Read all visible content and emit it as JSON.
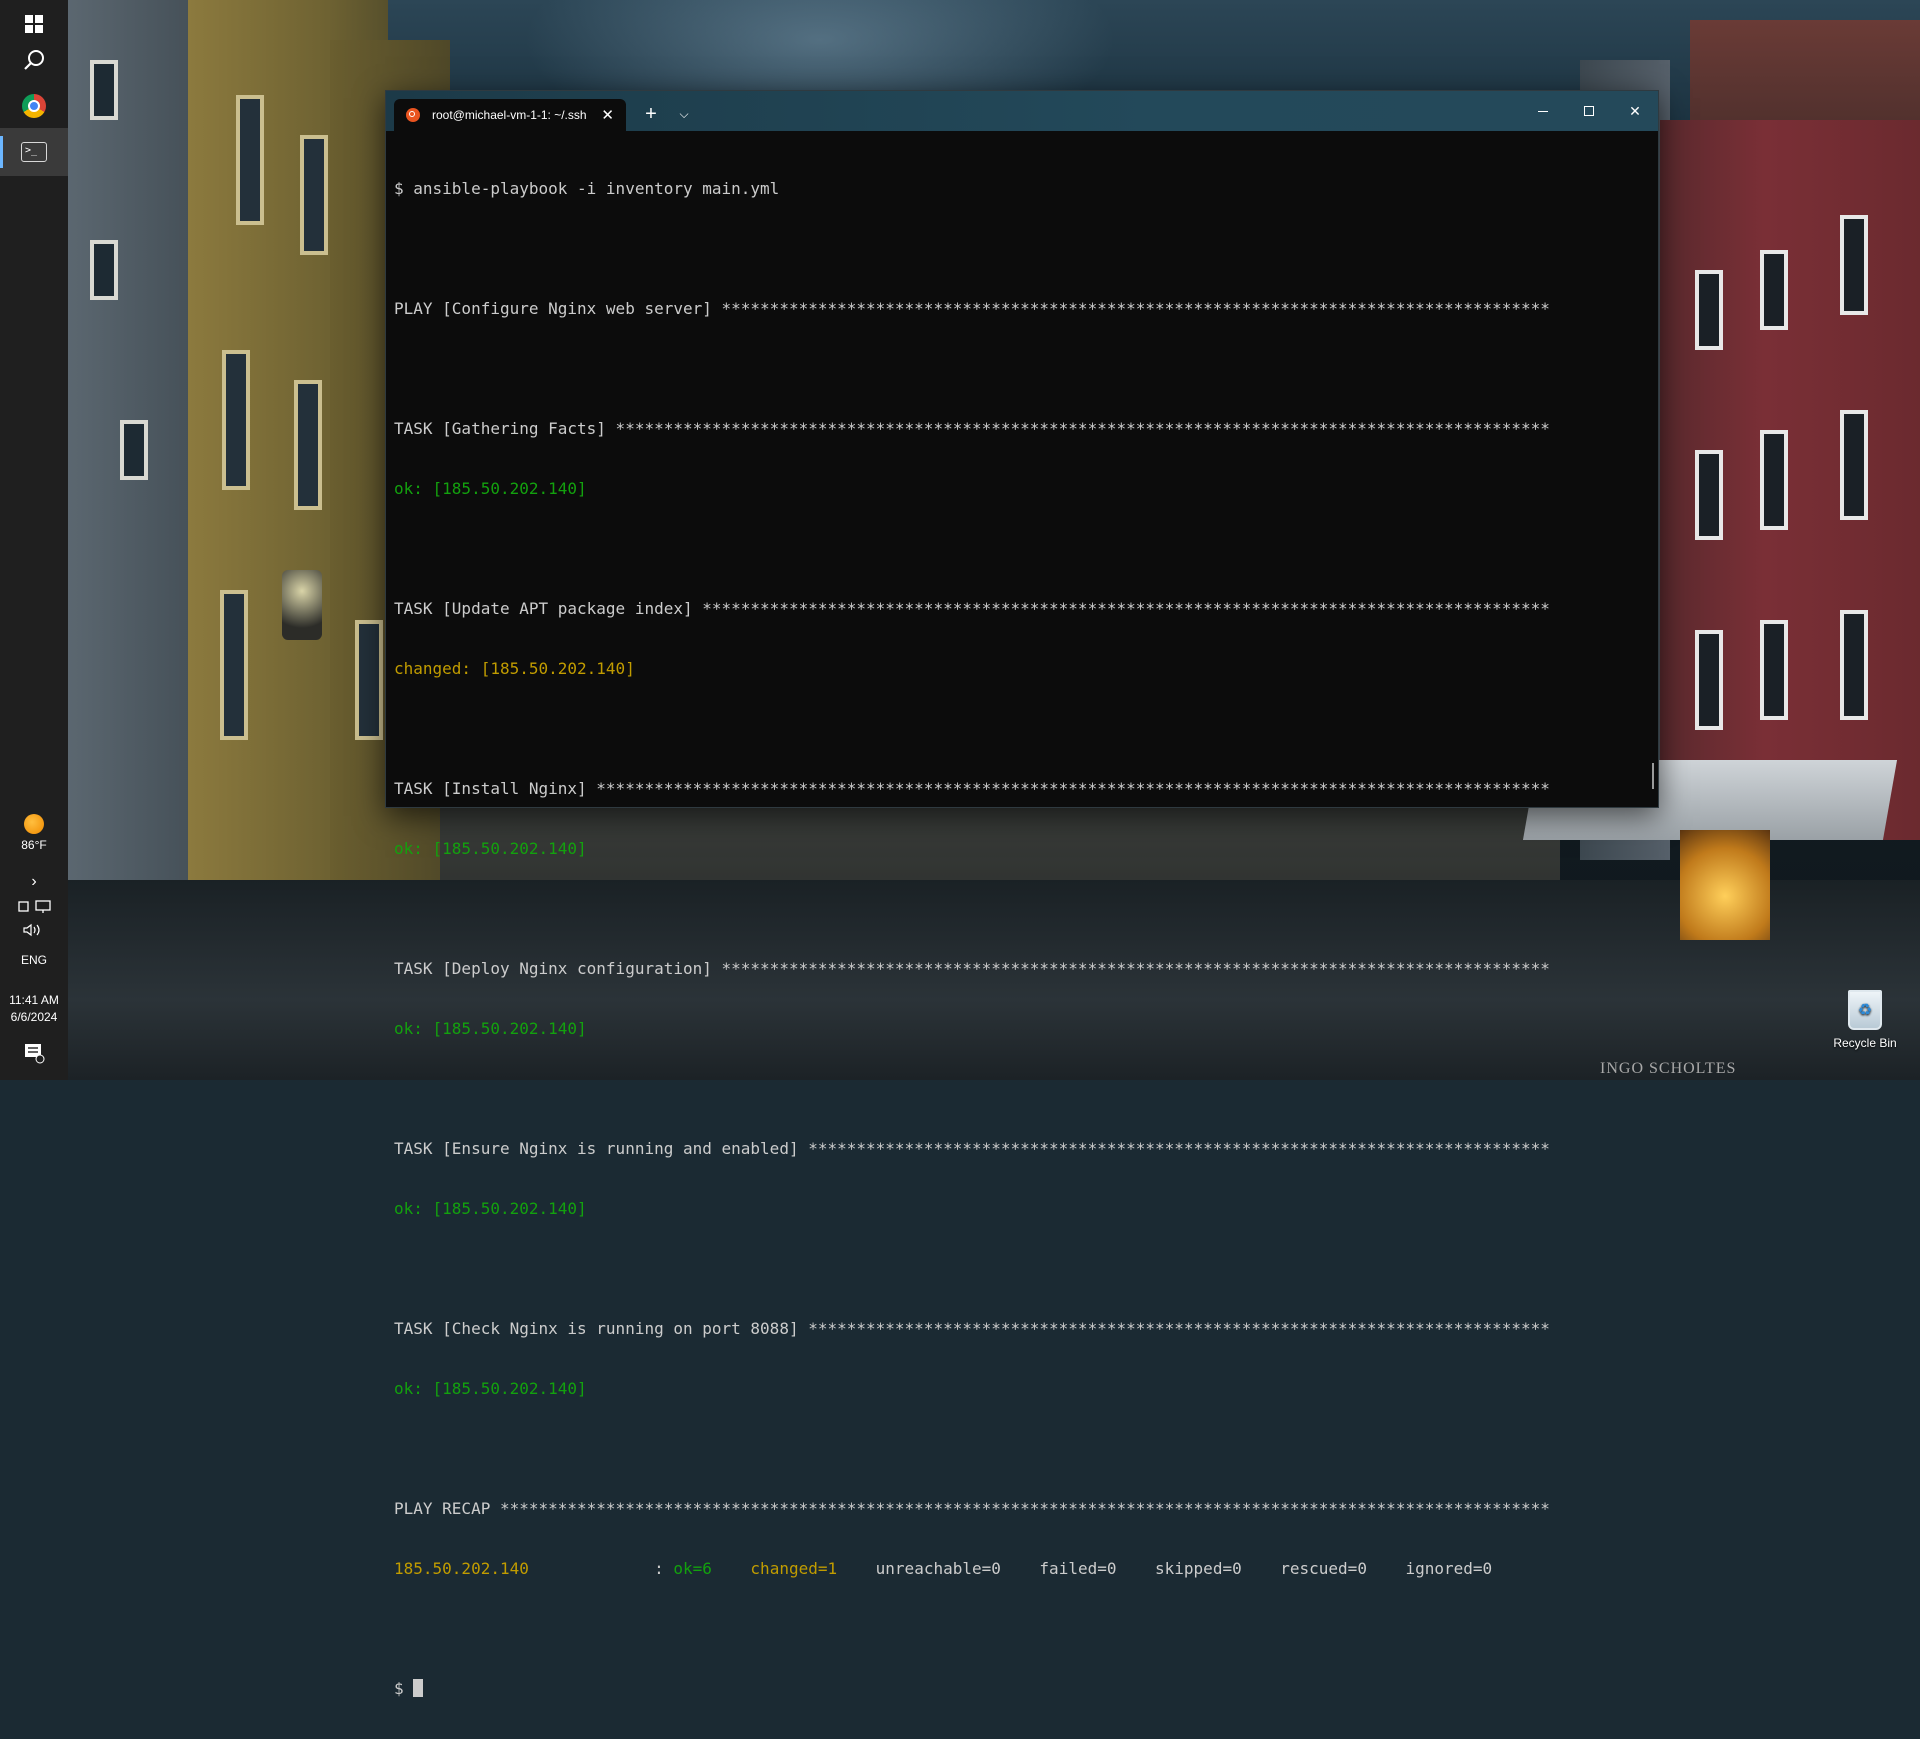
{
  "taskbar": {
    "icons": [
      "windows-start-icon",
      "search-icon",
      "chrome-icon",
      "terminal-icon"
    ],
    "weather": "86°F",
    "language": "ENG",
    "time": "11:41 AM",
    "date": "6/6/2024"
  },
  "terminal": {
    "tab_title": "root@michael-vm-1-1: ~/.ssh",
    "accent": "#e95420",
    "colors": {
      "ok": "#13a10e",
      "changed": "#c19c00",
      "text": "#cccccc",
      "background": "#0c0c0c"
    },
    "lines": {
      "cmd": "$ ansible-playbook -i inventory main.yml",
      "play": "PLAY [Configure Nginx web server] **************************************************************************************",
      "task1": "TASK [Gathering Facts] *************************************************************************************************",
      "ok1": "ok: [185.50.202.140]",
      "task2": "TASK [Update APT package index] ****************************************************************************************",
      "changed2": "changed: [185.50.202.140]",
      "task3": "TASK [Install Nginx] ***************************************************************************************************",
      "ok3": "ok: [185.50.202.140]",
      "task4": "TASK [Deploy Nginx configuration] **************************************************************************************",
      "ok4": "ok: [185.50.202.140]",
      "task5": "TASK [Ensure Nginx is running and enabled] *****************************************************************************",
      "ok5": "ok: [185.50.202.140]",
      "task6": "TASK [Check Nginx is running on port 8088] *****************************************************************************",
      "ok6": "ok: [185.50.202.140]",
      "recap": "PLAY RECAP *************************************************************************************************************",
      "prompt": "$ "
    },
    "recap": {
      "host": "185.50.202.140",
      "sep": "             : ",
      "ok": "ok=6",
      "changed": "changed=1",
      "unreachable": "unreachable=0",
      "failed": "failed=0",
      "skipped": "skipped=0",
      "rescued": "rescued=0",
      "ignored": "ignored=0"
    }
  },
  "desktop": {
    "recycle_bin_label": "Recycle Bin",
    "watermark": "INGO SCHOLTES"
  }
}
